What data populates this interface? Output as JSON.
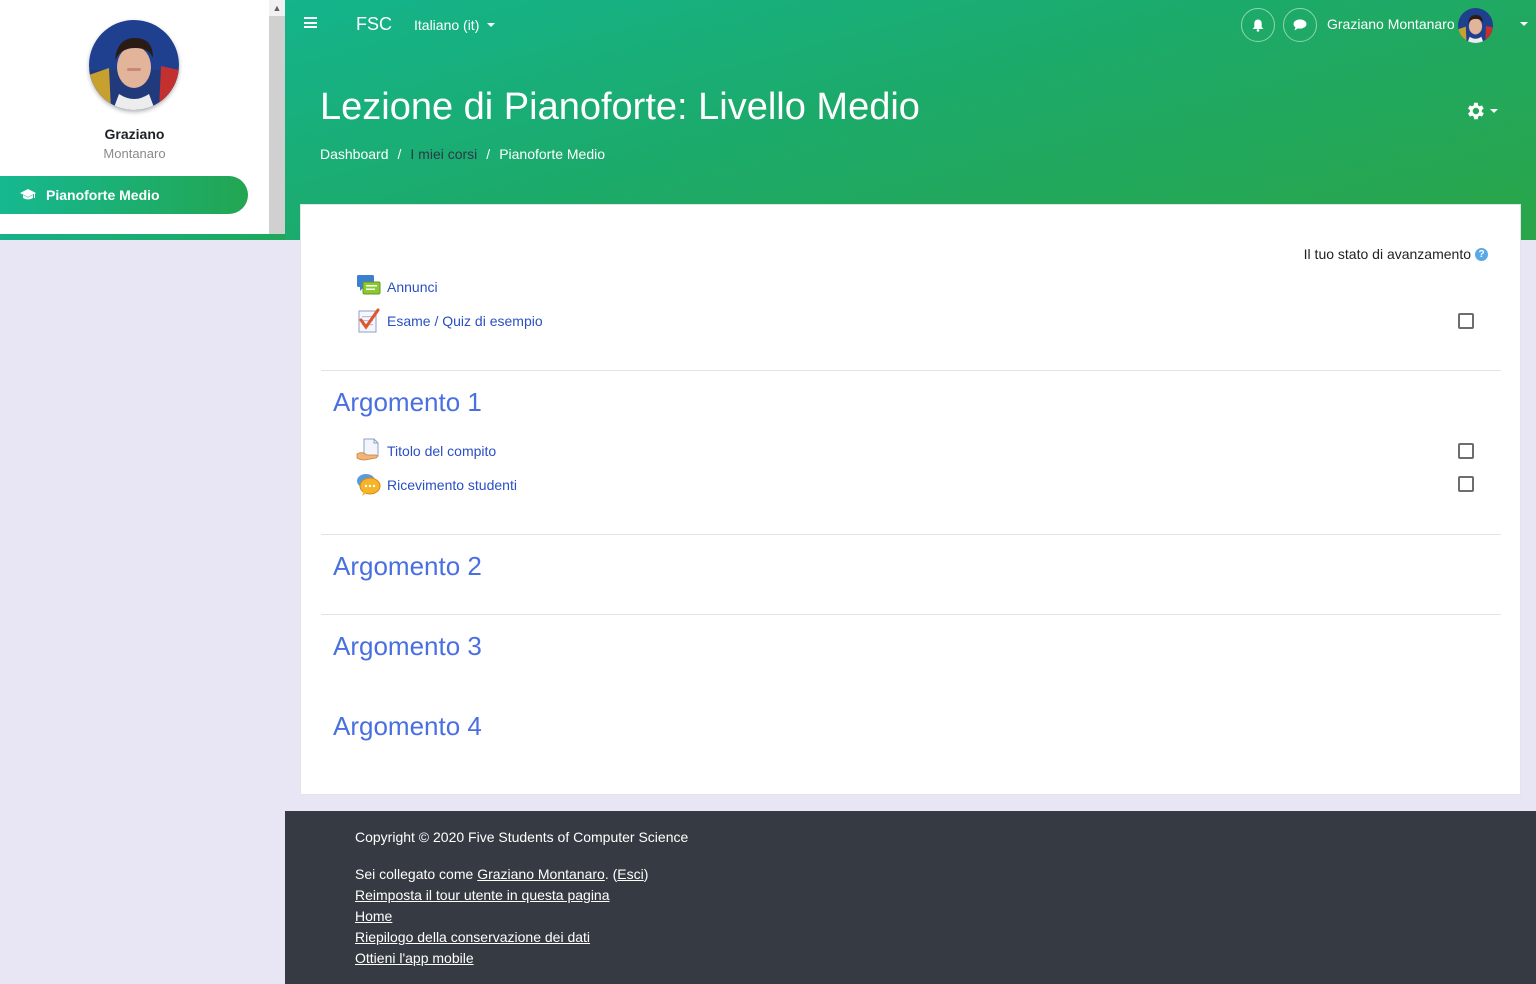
{
  "user": {
    "first_name": "Graziano",
    "last_name": "Montanaro",
    "full_name": "Graziano Montanaro"
  },
  "sidebar": {
    "active_item": "Pianoforte Medio"
  },
  "topbar": {
    "brand": "FSC",
    "language": "Italiano (it)"
  },
  "page": {
    "title": "Lezione di Pianoforte: Livello Medio",
    "breadcrumb": [
      "Dashboard",
      "I miei corsi",
      "Pianoforte Medio"
    ],
    "breadcrumb_separator": "/"
  },
  "course": {
    "progress_label": "Il tuo stato di avanzamento",
    "help_glyph": "?",
    "general_activities": [
      {
        "label": "Annunci",
        "icon": "forum-icon",
        "has_checkbox": false
      },
      {
        "label": "Esame / Quiz di esempio",
        "icon": "quiz-icon",
        "has_checkbox": true,
        "checked": false
      }
    ],
    "sections": [
      {
        "title": "Argomento 1",
        "activities": [
          {
            "label": "Titolo del compito",
            "icon": "assignment-icon",
            "has_checkbox": true,
            "checked": false
          },
          {
            "label": "Ricevimento studenti",
            "icon": "chat-icon",
            "has_checkbox": true,
            "checked": false
          }
        ]
      },
      {
        "title": "Argomento 2",
        "activities": []
      },
      {
        "title": "Argomento 3",
        "activities": []
      },
      {
        "title": "Argomento 4",
        "activities": []
      }
    ]
  },
  "footer": {
    "copyright": "Copyright © 2020 Five Students of Computer Science",
    "logged_in_prefix": "Sei collegato come ",
    "logged_in_user": "Graziano Montanaro",
    "logged_in_mid": ". (",
    "logout": "Esci",
    "logged_in_suffix": ")",
    "links": [
      "Reimposta il tour utente in questa pagina",
      "Home",
      "Riepilogo della conservazione dei dati",
      "Ottieni l'app mobile"
    ]
  },
  "colors": {
    "header_gradient_start": "#14b48c",
    "header_gradient_end": "#2aa548",
    "link": "#2a4fc4",
    "section_title": "#4a6fe0",
    "footer_bg": "#363a42",
    "page_bg": "#e8e6f4"
  }
}
